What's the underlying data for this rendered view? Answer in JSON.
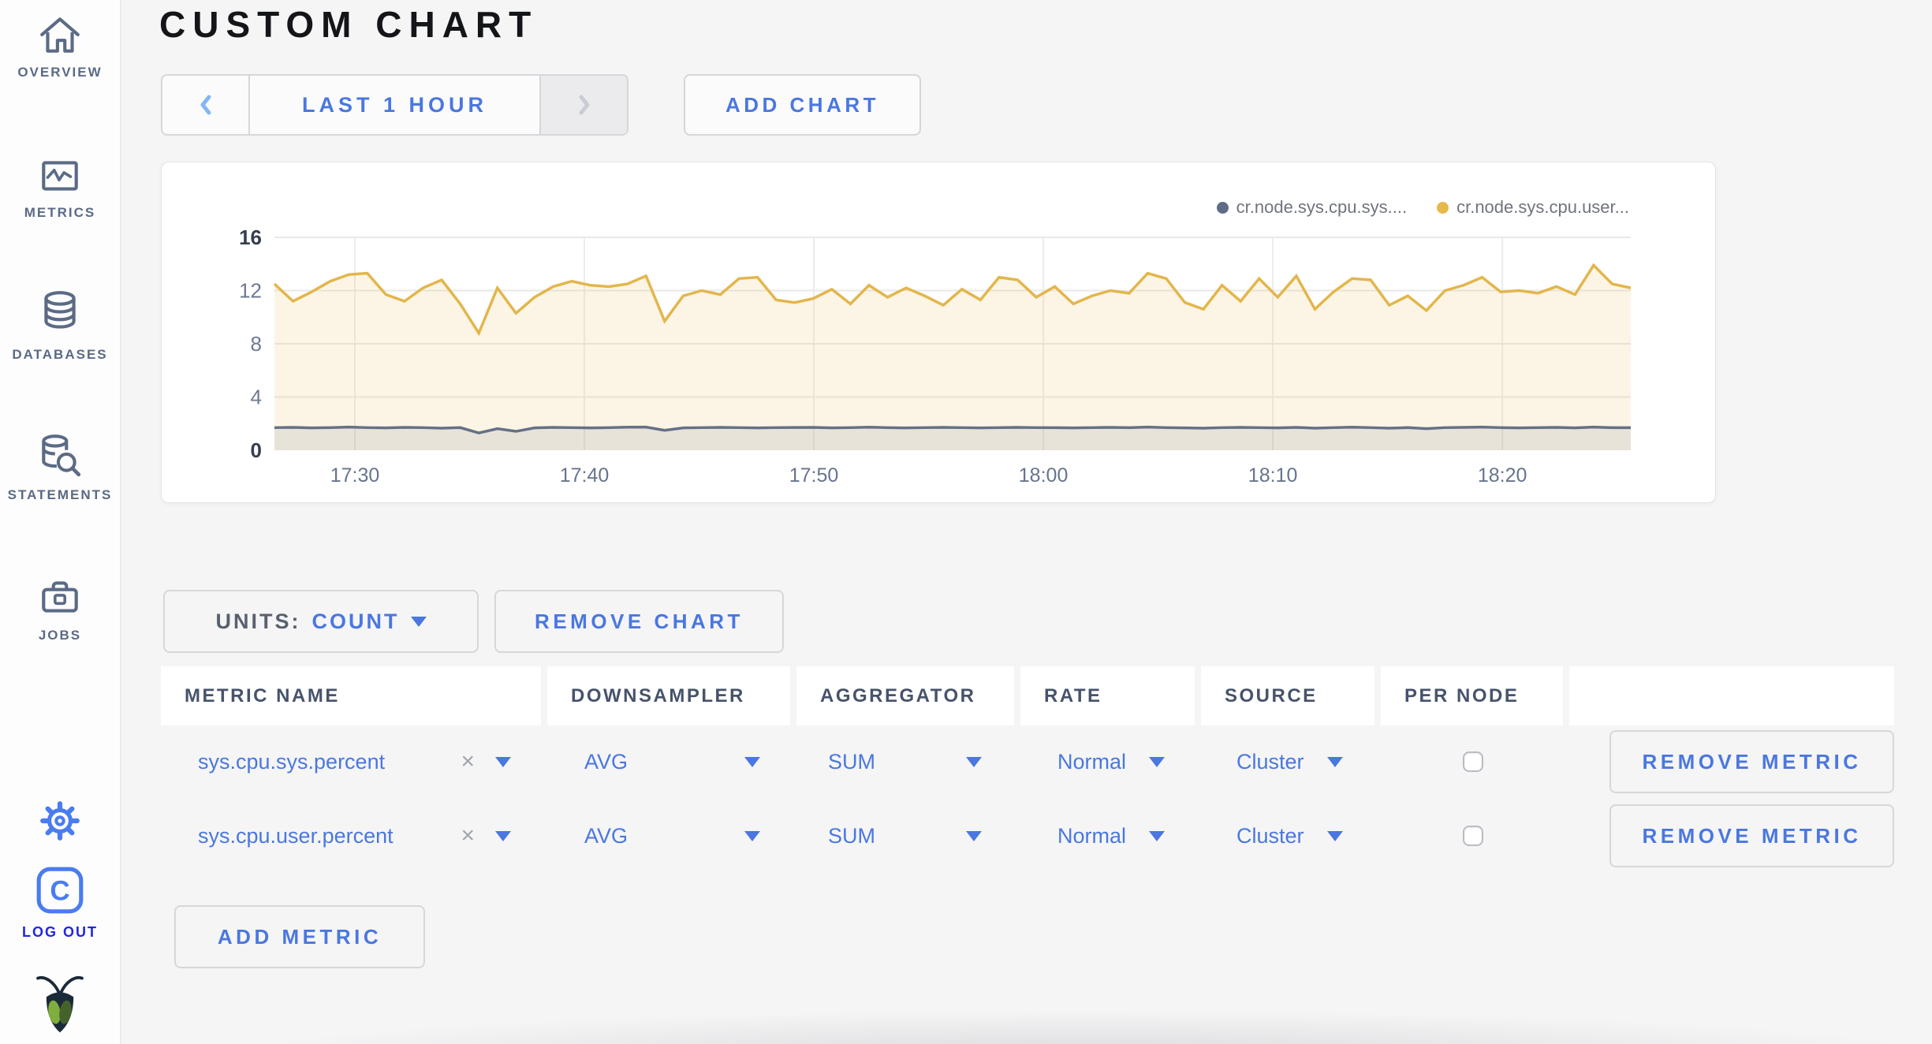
{
  "header": {
    "title": "CUSTOM CHART"
  },
  "sidebar": {
    "items": [
      {
        "label": "OVERVIEW"
      },
      {
        "label": "METRICS"
      },
      {
        "label": "DATABASES"
      },
      {
        "label": "STATEMENTS"
      },
      {
        "label": "JOBS"
      }
    ],
    "logout_label": "LOG OUT"
  },
  "toolbar": {
    "time_range_label": "LAST 1 HOUR",
    "add_chart_label": "ADD CHART"
  },
  "chart_controls": {
    "units_label": "UNITS:",
    "units_value": "COUNT",
    "remove_chart_label": "REMOVE CHART",
    "add_metric_label": "ADD METRIC",
    "remove_x": "×"
  },
  "chart_data": {
    "type": "area",
    "title": "",
    "xlabel": "",
    "ylabel": "",
    "ylim": [
      0,
      16
    ],
    "y_ticks": [
      0,
      4,
      8,
      12,
      16
    ],
    "x_ticks": [
      "17:30",
      "17:40",
      "17:50",
      "18:00",
      "18:10",
      "18:20"
    ],
    "x_tick_fractions": [
      0.0593,
      0.2285,
      0.3977,
      0.5669,
      0.7361,
      0.9053
    ],
    "grid": true,
    "legend_position": "top-right",
    "legend": [
      {
        "name": "cr.node.sys.cpu.sys....",
        "color": "#5f6c87"
      },
      {
        "name": "cr.node.sys.cpu.user...",
        "color": "#e7b94c"
      }
    ],
    "series": [
      {
        "name": "cr.node.sys.cpu.user...",
        "color": "#e3b64b",
        "fill": "rgba(231,185,76,0.14)",
        "values": [
          12.5,
          11.2,
          11.9,
          12.7,
          13.2,
          13.3,
          11.7,
          11.2,
          12.2,
          12.8,
          11.0,
          8.8,
          12.2,
          10.3,
          11.5,
          12.3,
          12.7,
          12.4,
          12.3,
          12.5,
          13.1,
          9.7,
          11.6,
          12.0,
          11.7,
          12.9,
          13.0,
          11.3,
          11.1,
          11.4,
          12.1,
          11.0,
          12.4,
          11.5,
          12.2,
          11.6,
          10.9,
          12.1,
          11.3,
          13.0,
          12.8,
          11.5,
          12.3,
          11.0,
          11.6,
          12.0,
          11.8,
          13.3,
          12.9,
          11.1,
          10.6,
          12.4,
          11.2,
          12.9,
          11.5,
          13.1,
          10.6,
          11.9,
          12.9,
          12.8,
          10.9,
          11.6,
          10.5,
          12.0,
          12.4,
          13.0,
          11.9,
          12.0,
          11.8,
          12.3,
          11.7,
          13.9,
          12.5,
          12.2
        ]
      },
      {
        "name": "cr.node.sys.cpu.sys....",
        "color": "#667086",
        "fill": "rgba(103,111,128,0.13)",
        "values": [
          1.7,
          1.72,
          1.68,
          1.7,
          1.74,
          1.7,
          1.68,
          1.72,
          1.7,
          1.66,
          1.7,
          1.3,
          1.62,
          1.42,
          1.68,
          1.72,
          1.7,
          1.68,
          1.7,
          1.73,
          1.74,
          1.5,
          1.68,
          1.7,
          1.72,
          1.7,
          1.68,
          1.7,
          1.71,
          1.72,
          1.68,
          1.7,
          1.73,
          1.7,
          1.68,
          1.7,
          1.72,
          1.7,
          1.68,
          1.7,
          1.72,
          1.7,
          1.7,
          1.68,
          1.7,
          1.72,
          1.7,
          1.74,
          1.7,
          1.68,
          1.66,
          1.7,
          1.72,
          1.7,
          1.68,
          1.72,
          1.66,
          1.7,
          1.73,
          1.7,
          1.66,
          1.7,
          1.62,
          1.7,
          1.72,
          1.74,
          1.7,
          1.68,
          1.7,
          1.72,
          1.68,
          1.74,
          1.7,
          1.7
        ]
      }
    ]
  },
  "table": {
    "headers": [
      "METRIC NAME",
      "DOWNSAMPLER",
      "AGGREGATOR",
      "RATE",
      "SOURCE",
      "PER NODE",
      ""
    ],
    "rows": [
      {
        "metric": "sys.cpu.sys.percent",
        "downsampler": "AVG",
        "aggregator": "SUM",
        "rate": "Normal",
        "source": "Cluster",
        "per_node_checked": false,
        "remove_label": "REMOVE METRIC"
      },
      {
        "metric": "sys.cpu.user.percent",
        "downsampler": "AVG",
        "aggregator": "SUM",
        "rate": "Normal",
        "source": "Cluster",
        "per_node_checked": false,
        "remove_label": "REMOVE METRIC"
      }
    ]
  },
  "colors": {
    "accent_blue": "#4a77e0",
    "logout_blue": "#2125e8",
    "slate": "#5a6a85",
    "series_yellow": "#e3b64b",
    "series_gray": "#667086",
    "page_bg": "#f5f5f6"
  }
}
